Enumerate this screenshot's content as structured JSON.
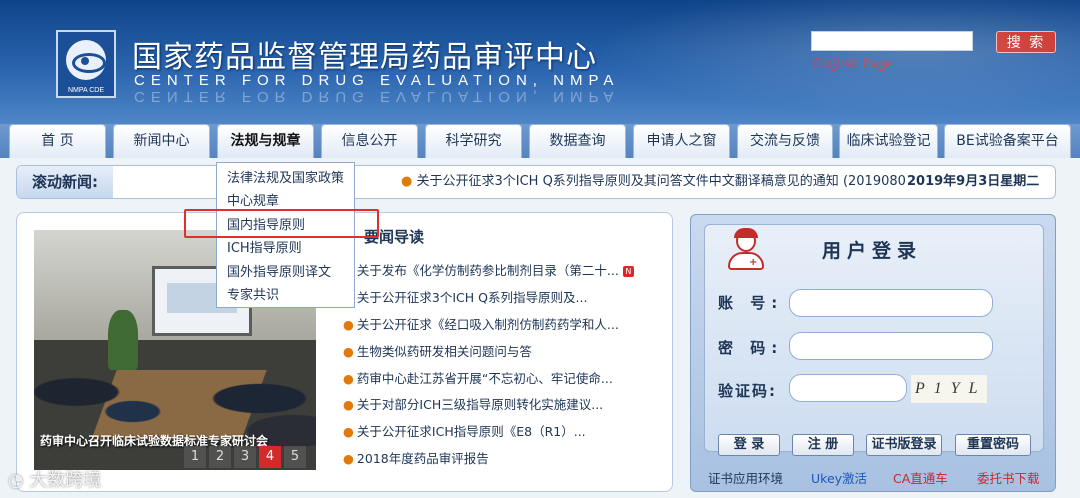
{
  "header": {
    "logo_text": "NMPA CDE",
    "title_cn": "国家药品监督管理局药品审评中心",
    "title_en": "CENTER FOR DRUG EVALUATION, NMPA",
    "search_button": "搜 索",
    "search_value": "",
    "english_link": "English Page"
  },
  "nav": {
    "tabs": [
      {
        "label": "首 页"
      },
      {
        "label": "新闻中心"
      },
      {
        "label": "法规与规章"
      },
      {
        "label": "信息公开"
      },
      {
        "label": "科学研究"
      },
      {
        "label": "数据查询"
      },
      {
        "label": "申请人之窗"
      },
      {
        "label": "交流与反馈"
      },
      {
        "label": "临床试验登记"
      },
      {
        "label": "BE试验备案平台"
      }
    ]
  },
  "dropdown": {
    "items": [
      "法律法规及国家政策",
      "中心规章",
      "国内指导原则",
      "ICH指导原则",
      "国外指导原则译文",
      "专家共识"
    ]
  },
  "ticker": {
    "label": "滚动新闻:",
    "text": "关于公开征求3个ICH Q系列指导原则及其问答文件中文翻译稿意见的通知 (2019080",
    "date": "2019年9月3日星期二"
  },
  "news": {
    "heading": "要闻导读",
    "photo_caption": "药审中心召开临床试验数据标准专家研讨会",
    "pager": [
      "1",
      "2",
      "3",
      "4",
      "5"
    ],
    "items": [
      "关于发布《化学仿制药参比制剂目录（第二十...",
      "关于公开征求3个ICH Q系列指导原则及...",
      "关于公开征求《经口吸入制剂仿制药药学和人...",
      "生物类似药研发相关问题问与答",
      "药审中心赴江苏省开展“不忘初心、牢记使命...",
      "关于对部分ICH三级指导原则转化实施建议...",
      "关于公开征求ICH指导原则《E8（R1）...",
      "2018年度药品审评报告"
    ],
    "new_badge": "N"
  },
  "login": {
    "title": "用户登录",
    "account_label": "账 号:",
    "password_label": "密 码:",
    "captcha_label": "验证码:",
    "captcha_text": "P1YL",
    "buttons": [
      "登 录",
      "注 册",
      "证书版登录",
      "重置密码"
    ],
    "links": [
      "证书应用环境",
      "Ukey激活",
      "CA直通车",
      "委托书下载"
    ]
  },
  "watermark": "大数跨境"
}
